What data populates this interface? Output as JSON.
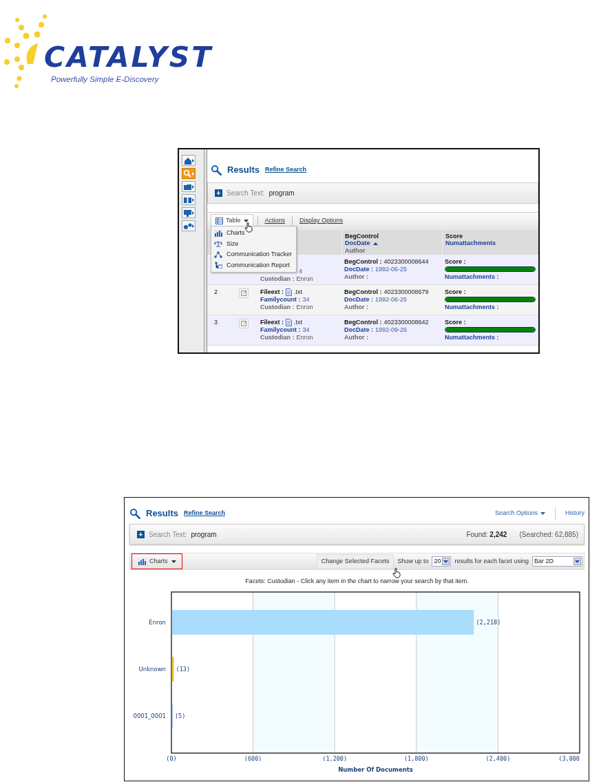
{
  "logo": {
    "name": "CATALYST",
    "tagline": "Powerfully Simple E-Discovery"
  },
  "screen_1": {
    "sidebar": {
      "items": [
        {
          "selected": false
        },
        {
          "selected": true
        },
        {
          "selected": false
        },
        {
          "selected": false
        },
        {
          "selected": false
        },
        {
          "selected": false
        }
      ]
    },
    "header": {
      "title": "Results",
      "link": "Refine Search"
    },
    "search_bar": {
      "expand": "+",
      "label": "Search Text:",
      "value": "program"
    },
    "toolbar": {
      "view_button": "Table",
      "items": [
        "Actions",
        "Display Options"
      ]
    },
    "view_menu": {
      "items": [
        "Charts",
        "Size",
        "Communication Tracker",
        "Communication Report"
      ]
    },
    "table": {
      "columns": [
        {
          "lines": [
            {
              "text": "BegControl",
              "kind": "plain"
            },
            {
              "text": "DocDate",
              "kind": "link",
              "sorted_ascending": true
            },
            {
              "text": "Author",
              "kind": "muted"
            }
          ]
        },
        {
          "lines": [
            {
              "text": "Score",
              "kind": "plain"
            },
            {
              "text": "Numattachments",
              "kind": "link"
            }
          ]
        }
      ],
      "rows": [
        {
          "number": "",
          "doc": [
            {
              "kind": "fragment",
              "value": "4"
            },
            {
              "kind": "muted",
              "label": "Custodian :",
              "value": "Enron"
            }
          ],
          "meta": [
            {
              "kind": "plain",
              "label": "BegControl :",
              "value": "4023300008644"
            },
            {
              "kind": "link",
              "label": "DocDate :",
              "value": "1992-06-25"
            },
            {
              "kind": "muted",
              "label": "Author :"
            }
          ],
          "score": [
            {
              "kind": "bar",
              "label": "Score :",
              "level": 1
            },
            {
              "kind": "link",
              "label": "Numattachments :"
            }
          ]
        },
        {
          "number": "2",
          "doc": [
            {
              "kind": "file",
              "label": "Fileext :",
              "value": ".txt"
            },
            {
              "kind": "link",
              "label": "Familycount :",
              "value": "34"
            },
            {
              "kind": "muted",
              "label": "Custodian :",
              "value": "Enron"
            }
          ],
          "meta": [
            {
              "kind": "plain",
              "label": "BegControl :",
              "value": "4023300008679"
            },
            {
              "kind": "link",
              "label": "DocDate :",
              "value": "1992-06-25"
            },
            {
              "kind": "muted",
              "label": "Author :"
            }
          ],
          "score": [
            {
              "kind": "bar",
              "label": "Score :",
              "level": 1
            },
            {
              "kind": "link",
              "label": "Numattachments :"
            }
          ]
        },
        {
          "number": "3",
          "doc": [
            {
              "kind": "file",
              "label": "Fileext :",
              "value": ".txt"
            },
            {
              "kind": "link",
              "label": "Familycount :",
              "value": "34"
            },
            {
              "kind": "muted",
              "label": "Custodian :",
              "value": "Enron"
            }
          ],
          "meta": [
            {
              "kind": "plain",
              "label": "BegControl :",
              "value": "4023300008642"
            },
            {
              "kind": "link",
              "label": "DocDate :",
              "value": "1992-09-26"
            },
            {
              "kind": "muted",
              "label": "Author :"
            }
          ],
          "score": [
            {
              "kind": "bar",
              "label": "Score :",
              "level": 1
            },
            {
              "kind": "link",
              "label": "Numattachments :"
            }
          ]
        }
      ]
    }
  },
  "screen_2": {
    "header": {
      "title": "Results",
      "link": "Refine Search",
      "menu": "Search Options",
      "history": "History"
    },
    "search_bar": {
      "expand": "+",
      "label": "Search Text:",
      "value": "program",
      "found_label": "Found:",
      "found": "2,242",
      "searched": "(Searched: 62,885)"
    },
    "toolbar": {
      "view_button": "Charts",
      "highlighted": true,
      "facets_button": "Change Selected Facets",
      "show_label": "Show up to",
      "count": "20",
      "using_label": "results for each facet using",
      "chart_type": "Bar 2D"
    },
    "chart_title": "Facets: Custodian - Click any item in the chart to narrow your search by that item.",
    "chart_data": {
      "type": "bar",
      "orientation": "horizontal",
      "xlabel": "Number Of Documents",
      "categories": [
        "Enron",
        "Unknown",
        "0001_0001"
      ],
      "series": [
        {
          "color": "#aadcfc",
          "values": [
            2218,
            null,
            null
          ]
        },
        {
          "color": "#f2c31c",
          "values": [
            null,
            13,
            null
          ]
        },
        {
          "color": "#8cb8e8",
          "values": [
            null,
            null,
            5
          ]
        }
      ],
      "grid": true,
      "value_labels": [
        "(2,218)",
        "(13)",
        "(5)"
      ],
      "xlim": [
        0,
        3000
      ],
      "xticks": [
        {
          "value": 0,
          "label": "(0)"
        },
        {
          "value": 600,
          "label": "(600)"
        },
        {
          "value": 1200,
          "label": "(1,200)"
        },
        {
          "value": 1800,
          "label": "(1,800)"
        },
        {
          "value": 2400,
          "label": "(2,400)"
        },
        {
          "value": 3000,
          "label": "(3,000"
        }
      ]
    }
  }
}
